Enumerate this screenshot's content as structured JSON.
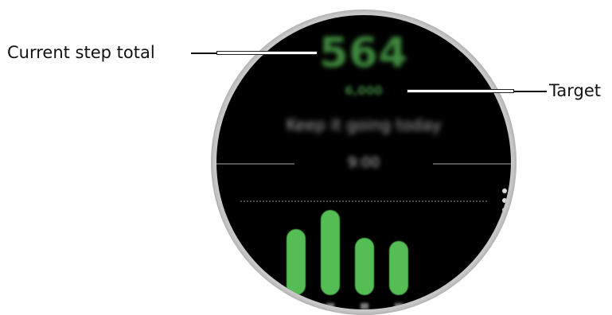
{
  "callouts": {
    "current_step_total": "Current step total",
    "target": "Target"
  },
  "screen": {
    "step_count": "564",
    "step_target": "6,000",
    "status_text": "Keep it going today",
    "period_label": "9:00",
    "menu_icon": "more-vertical-icon"
  },
  "bar_chart": {
    "values": [
      0.67,
      0.86,
      0.58,
      0.55
    ]
  },
  "colors": {
    "screen_bg": "#000000",
    "bezel": "#c9c9c9",
    "step_green": "#3f8a3f",
    "bar_green": "#54bd54"
  }
}
